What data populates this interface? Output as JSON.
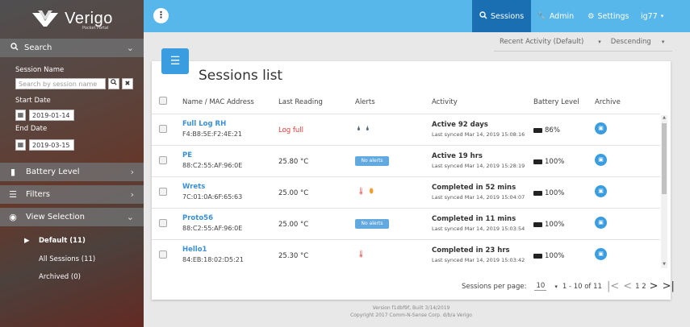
{
  "sidebar": {
    "logo": {
      "name": "Verigo",
      "subtitle": "Pocket Portal"
    },
    "search_header": "Search",
    "session_name_label": "Session Name",
    "search_placeholder": "Search by session name",
    "start_date_label": "Start Date",
    "start_date": "2019-01-14",
    "end_date_label": "End Date",
    "end_date": "2019-03-15",
    "battery_level": "Battery Level",
    "filters": "Filters",
    "view_selection": "View Selection",
    "view_items": [
      "Default (11)",
      "All Sessions (11)",
      "Archived (0)"
    ]
  },
  "topbar": {
    "sessions": "Sessions",
    "admin": "Admin",
    "settings": "Settings",
    "user": "ig77",
    "accent": "#57b6ea",
    "active_color": "#1a6fb3"
  },
  "sortbar": {
    "sort_field": "Recent Activity (Default)",
    "sort_order": "Descending"
  },
  "main": {
    "title": "Sessions list",
    "columns": [
      "Name / MAC Address",
      "Last Reading",
      "Alerts",
      "Activity",
      "Battery Level",
      "Archive"
    ],
    "rows": [
      {
        "name": "Full Log RH",
        "mac": "F4:B8:5E:F2:4E:21",
        "reading": "Log full",
        "reading_red": true,
        "alerts": "icons-droplets",
        "activity": "Active 92 days",
        "synced": "Last synced Mar 14, 2019 15:08:16",
        "battery": "86%"
      },
      {
        "name": "PE",
        "mac": "88:C2:55:AF:96:0E",
        "reading": "25.80 °C",
        "alerts": "No alerts",
        "activity": "Active 19 hrs",
        "synced": "Last synced Mar 14, 2019 15:28:19",
        "battery": "100%"
      },
      {
        "name": "Wrets",
        "mac": "7C:01:0A:6F:65:63",
        "reading": "25.00 °C",
        "alerts": "icons-temp-humidity",
        "activity": "Completed in 52 mins",
        "synced": "Last synced Mar 14, 2019 15:04:07",
        "battery": "100%"
      },
      {
        "name": "Proto56",
        "mac": "88:C2:55:AF:96:0E",
        "reading": "25.00 °C",
        "alerts": "No alerts",
        "activity": "Completed in 11 mins",
        "synced": "Last synced Mar 14, 2019 15:03:54",
        "battery": "100%"
      },
      {
        "name": "Hello1",
        "mac": "84:EB:18:02:D5:21",
        "reading": "25.30 °C",
        "alerts": "icons-temp",
        "activity": "Completed in 23 hrs",
        "synced": "Last synced Mar 14, 2019 15:03:42",
        "battery": "100%"
      }
    ],
    "pager": {
      "label": "Sessions per page:",
      "per_page": "10",
      "range": "1 - 10 of 11",
      "pages": "1 2"
    }
  },
  "footer": {
    "line1": "Version f1dbf9f, Built 3/14/2019",
    "line2": "Copyright 2017 Comm-N-Sense Corp. d/b/a Verigo"
  }
}
